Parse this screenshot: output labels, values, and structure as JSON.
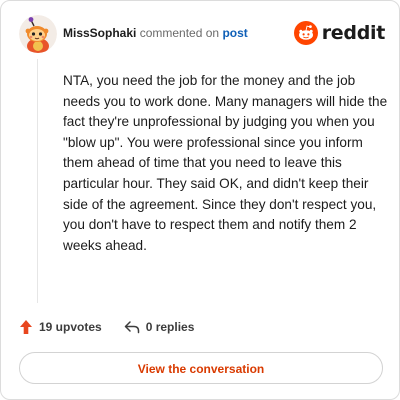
{
  "comment": {
    "username": "MissSophaki",
    "action_text": "commented on",
    "post_link_text": "post",
    "body": "NTA, you need the job for the money and the job needs you to work done. Many managers will hide the fact they're unprofessional by judging you when you \"blow up\". You were professional since you inform them ahead of time that you need to leave this particular hour. They said OK, and didn't keep their side of the agreement. Since they don't respect you, you don't have to respect them and notify them 2 weeks ahead."
  },
  "brand": {
    "logo_text": "reddit",
    "accent_color": "#ff4500"
  },
  "actions": {
    "upvotes_label": "19 upvotes",
    "replies_label": "0 replies"
  },
  "footer": {
    "button_label": "View the conversation"
  },
  "icons": {
    "upvote": "upvote-arrow-icon",
    "reply": "reply-arrow-icon",
    "logo": "snoo-icon",
    "avatar": "snoo-avatar"
  }
}
